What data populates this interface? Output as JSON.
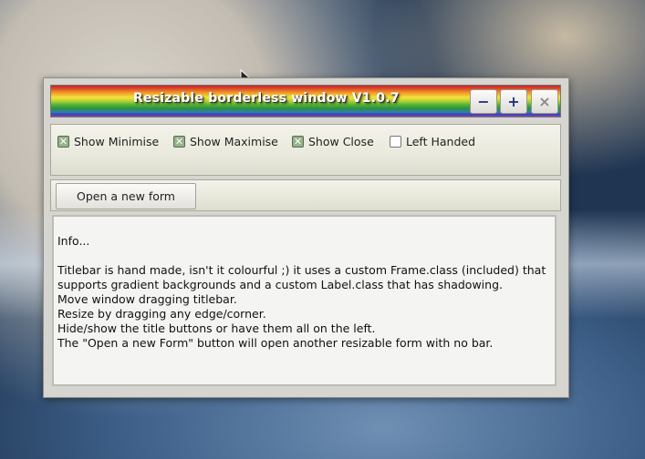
{
  "window": {
    "title": "Resizable borderless window V1.0.7",
    "buttons": {
      "minimise": "−",
      "maximise": "+",
      "close": "×"
    }
  },
  "options": [
    {
      "label": "Show Minimise",
      "checked": true
    },
    {
      "label": "Show Maximise",
      "checked": true
    },
    {
      "label": "Show Close",
      "checked": true
    },
    {
      "label": "Left Handed",
      "checked": false
    }
  ],
  "check_mark": "✕",
  "open_form_button": "Open a new form",
  "info": {
    "heading": "Info...",
    "lines": [
      "Titlebar is hand made, isn't it colourful ;) it uses a custom Frame.class (included) that",
      "supports gradient backgrounds and a custom Label.class that has shadowing.",
      "Move window dragging titlebar.",
      "Resize by dragging any edge/corner.",
      "Hide/show the title buttons or have them all on the left.",
      "The \"Open a new Form\" button will open another resizable form with no bar."
    ]
  }
}
